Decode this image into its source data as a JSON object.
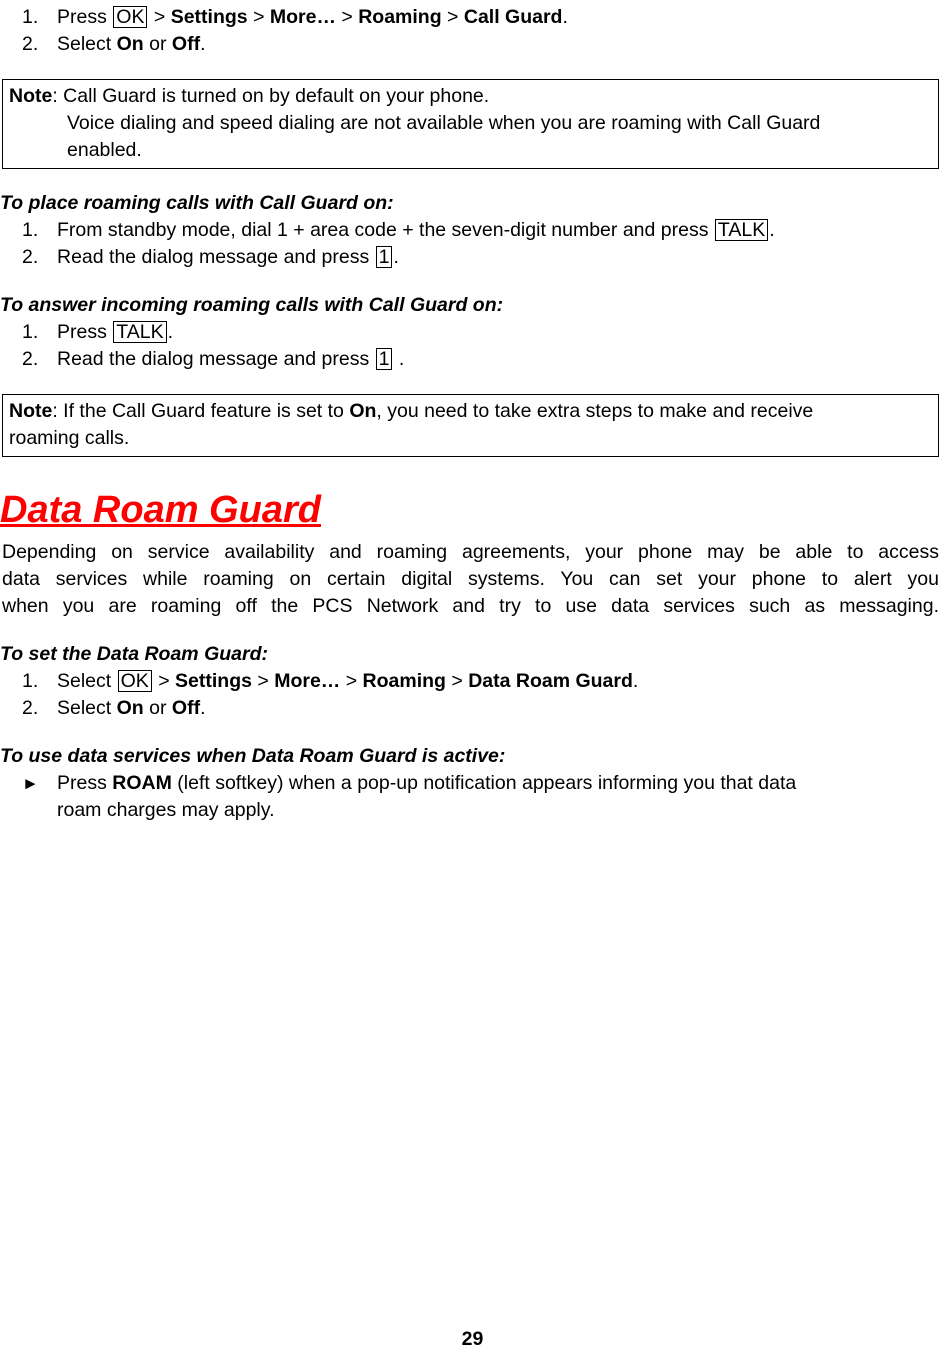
{
  "document": {
    "page_number": "29",
    "accent_color": "#FF0000"
  },
  "call_guard_steps": {
    "step1": {
      "num": "1.",
      "press_label": "Press",
      "key": "OK",
      "sep": ">",
      "item1": "Settings",
      "item2": "More…",
      "item3": "Roaming",
      "item4": "Call Guard",
      "period": "."
    },
    "step2": {
      "num": "2.",
      "select_label": "Select",
      "on": "On",
      "or": "or",
      "off": "Off",
      "period": "."
    }
  },
  "note_one": {
    "label": "Note",
    "line1": ": Call Guard is turned on by default on your phone.",
    "line2": "Voice dialing and speed dialing are not available when you are roaming with Call Guard",
    "line3": "enabled."
  },
  "place_calls": {
    "heading": "To place roaming calls with Call Guard on:",
    "step1": {
      "num": "1.",
      "text_before": "From standby mode, dial 1 + area code + the seven-digit number and press",
      "key": "TALK",
      "text_after": "."
    },
    "step2": {
      "num": "2.",
      "text_before": "Read the dialog message and press",
      "key": "1",
      "text_after": "."
    }
  },
  "answer_calls": {
    "heading": "To answer incoming roaming calls with Call Guard on:",
    "step1": {
      "num": "1.",
      "text_before": "Press",
      "key": "TALK",
      "text_after": "."
    },
    "step2": {
      "num": "2.",
      "text_before": "Read the dialog message and press",
      "key": "1",
      "text_after": "."
    }
  },
  "note_two": {
    "label": "Note",
    "part1": ": If the Call Guard feature is set to ",
    "bold_on": "On",
    "part2": ", you need to take extra steps to make and receive",
    "line2": "roaming calls."
  },
  "data_roam_guard": {
    "heading": "Data Roam Guard",
    "paragraph_line1": "Depending on service availability and roaming agreements, your phone may be able to access",
    "paragraph_line2": "data services while roaming on certain digital systems. You can set your phone to alert you",
    "paragraph_line3": "when you are roaming off the PCS Network and try to use data services such as messaging."
  },
  "set_data_roam_guard": {
    "heading": "To set the Data Roam Guard:",
    "step1": {
      "num": "1.",
      "select_label": "Select",
      "key": "OK",
      "sep": ">",
      "item1": "Settings",
      "item2": "More…",
      "item3": "Roaming",
      "item4": "Data Roam Guard",
      "period": "."
    },
    "step2": {
      "num": "2.",
      "select_label": "Select",
      "on": "On",
      "or": "or",
      "off": "Off",
      "period": "."
    }
  },
  "use_data_services": {
    "heading": "To use data services when Data Roam Guard is active:",
    "bullet_glyph": "►",
    "line1_before": "Press",
    "line1_bold": "ROAM",
    "line1_after": "(left softkey) when a pop-up notification appears informing you that data",
    "line2": "roam charges may apply."
  }
}
